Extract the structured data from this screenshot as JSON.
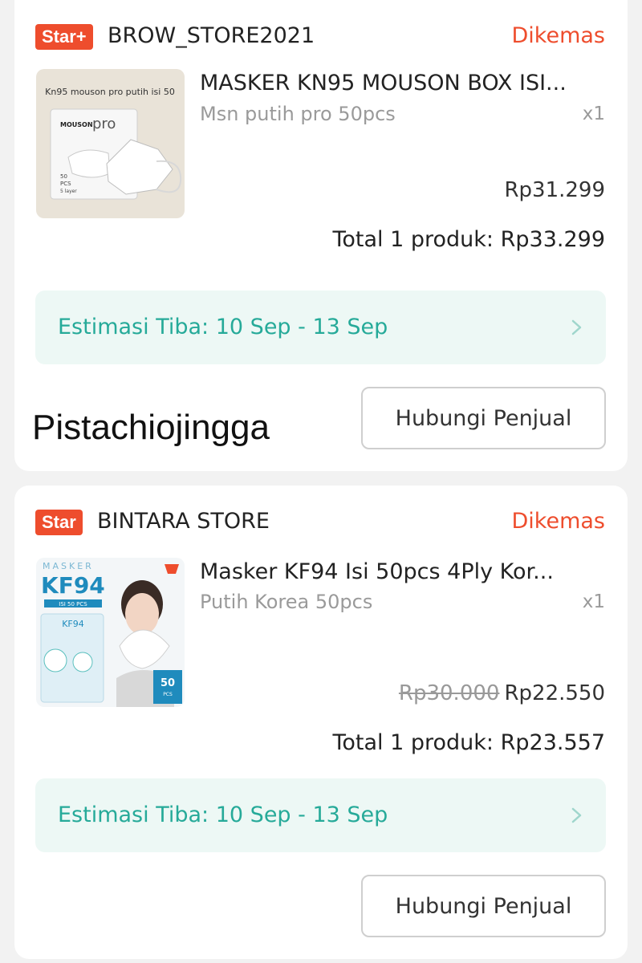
{
  "orders": [
    {
      "badge": "Star+",
      "store": "BROW_STORE2021",
      "status": "Dikemas",
      "product_title": "MASKER KN95 MOUSON BOX ISI...",
      "variant": "Msn putih pro 50pcs",
      "qty": "x1",
      "original_price": "",
      "price": "Rp31.299",
      "total_label": "Total 1 produk:",
      "total_amount": "Rp33.299",
      "eta": "Estimasi Tiba: 10 Sep - 13 Sep",
      "button": "Hubungi Penjual",
      "thumb_text": {
        "header": "Kn95 mouson pro putih isi 50",
        "brand": "MOUSON",
        "model": "pro",
        "count": "50",
        "pcs": "PCS",
        "layer": "5 layer"
      }
    },
    {
      "badge": "Star",
      "store": "BINTARA STORE",
      "status": "Dikemas",
      "product_title": "Masker KF94 Isi 50pcs 4Ply Kor...",
      "variant": "Putih Korea 50pcs",
      "qty": "x1",
      "original_price": "Rp30.000",
      "price": "Rp22.550",
      "total_label": "Total 1 produk:",
      "total_amount": "Rp23.557",
      "eta": "Estimasi Tiba: 10 Sep - 13 Sep",
      "button": "Hubungi Penjual",
      "thumb_text": {
        "masker": "MASKER",
        "model": "KF94",
        "isi": "ISI 50 PCS",
        "bag_model": "KF94",
        "count": "50",
        "pcs": "PCS"
      }
    }
  ],
  "watermark": "Pistachiojingga",
  "colors": {
    "accent": "#ee4d2d",
    "eta_text": "#26aa99",
    "eta_bg": "#edf8f5",
    "muted": "#9a9a9a"
  }
}
